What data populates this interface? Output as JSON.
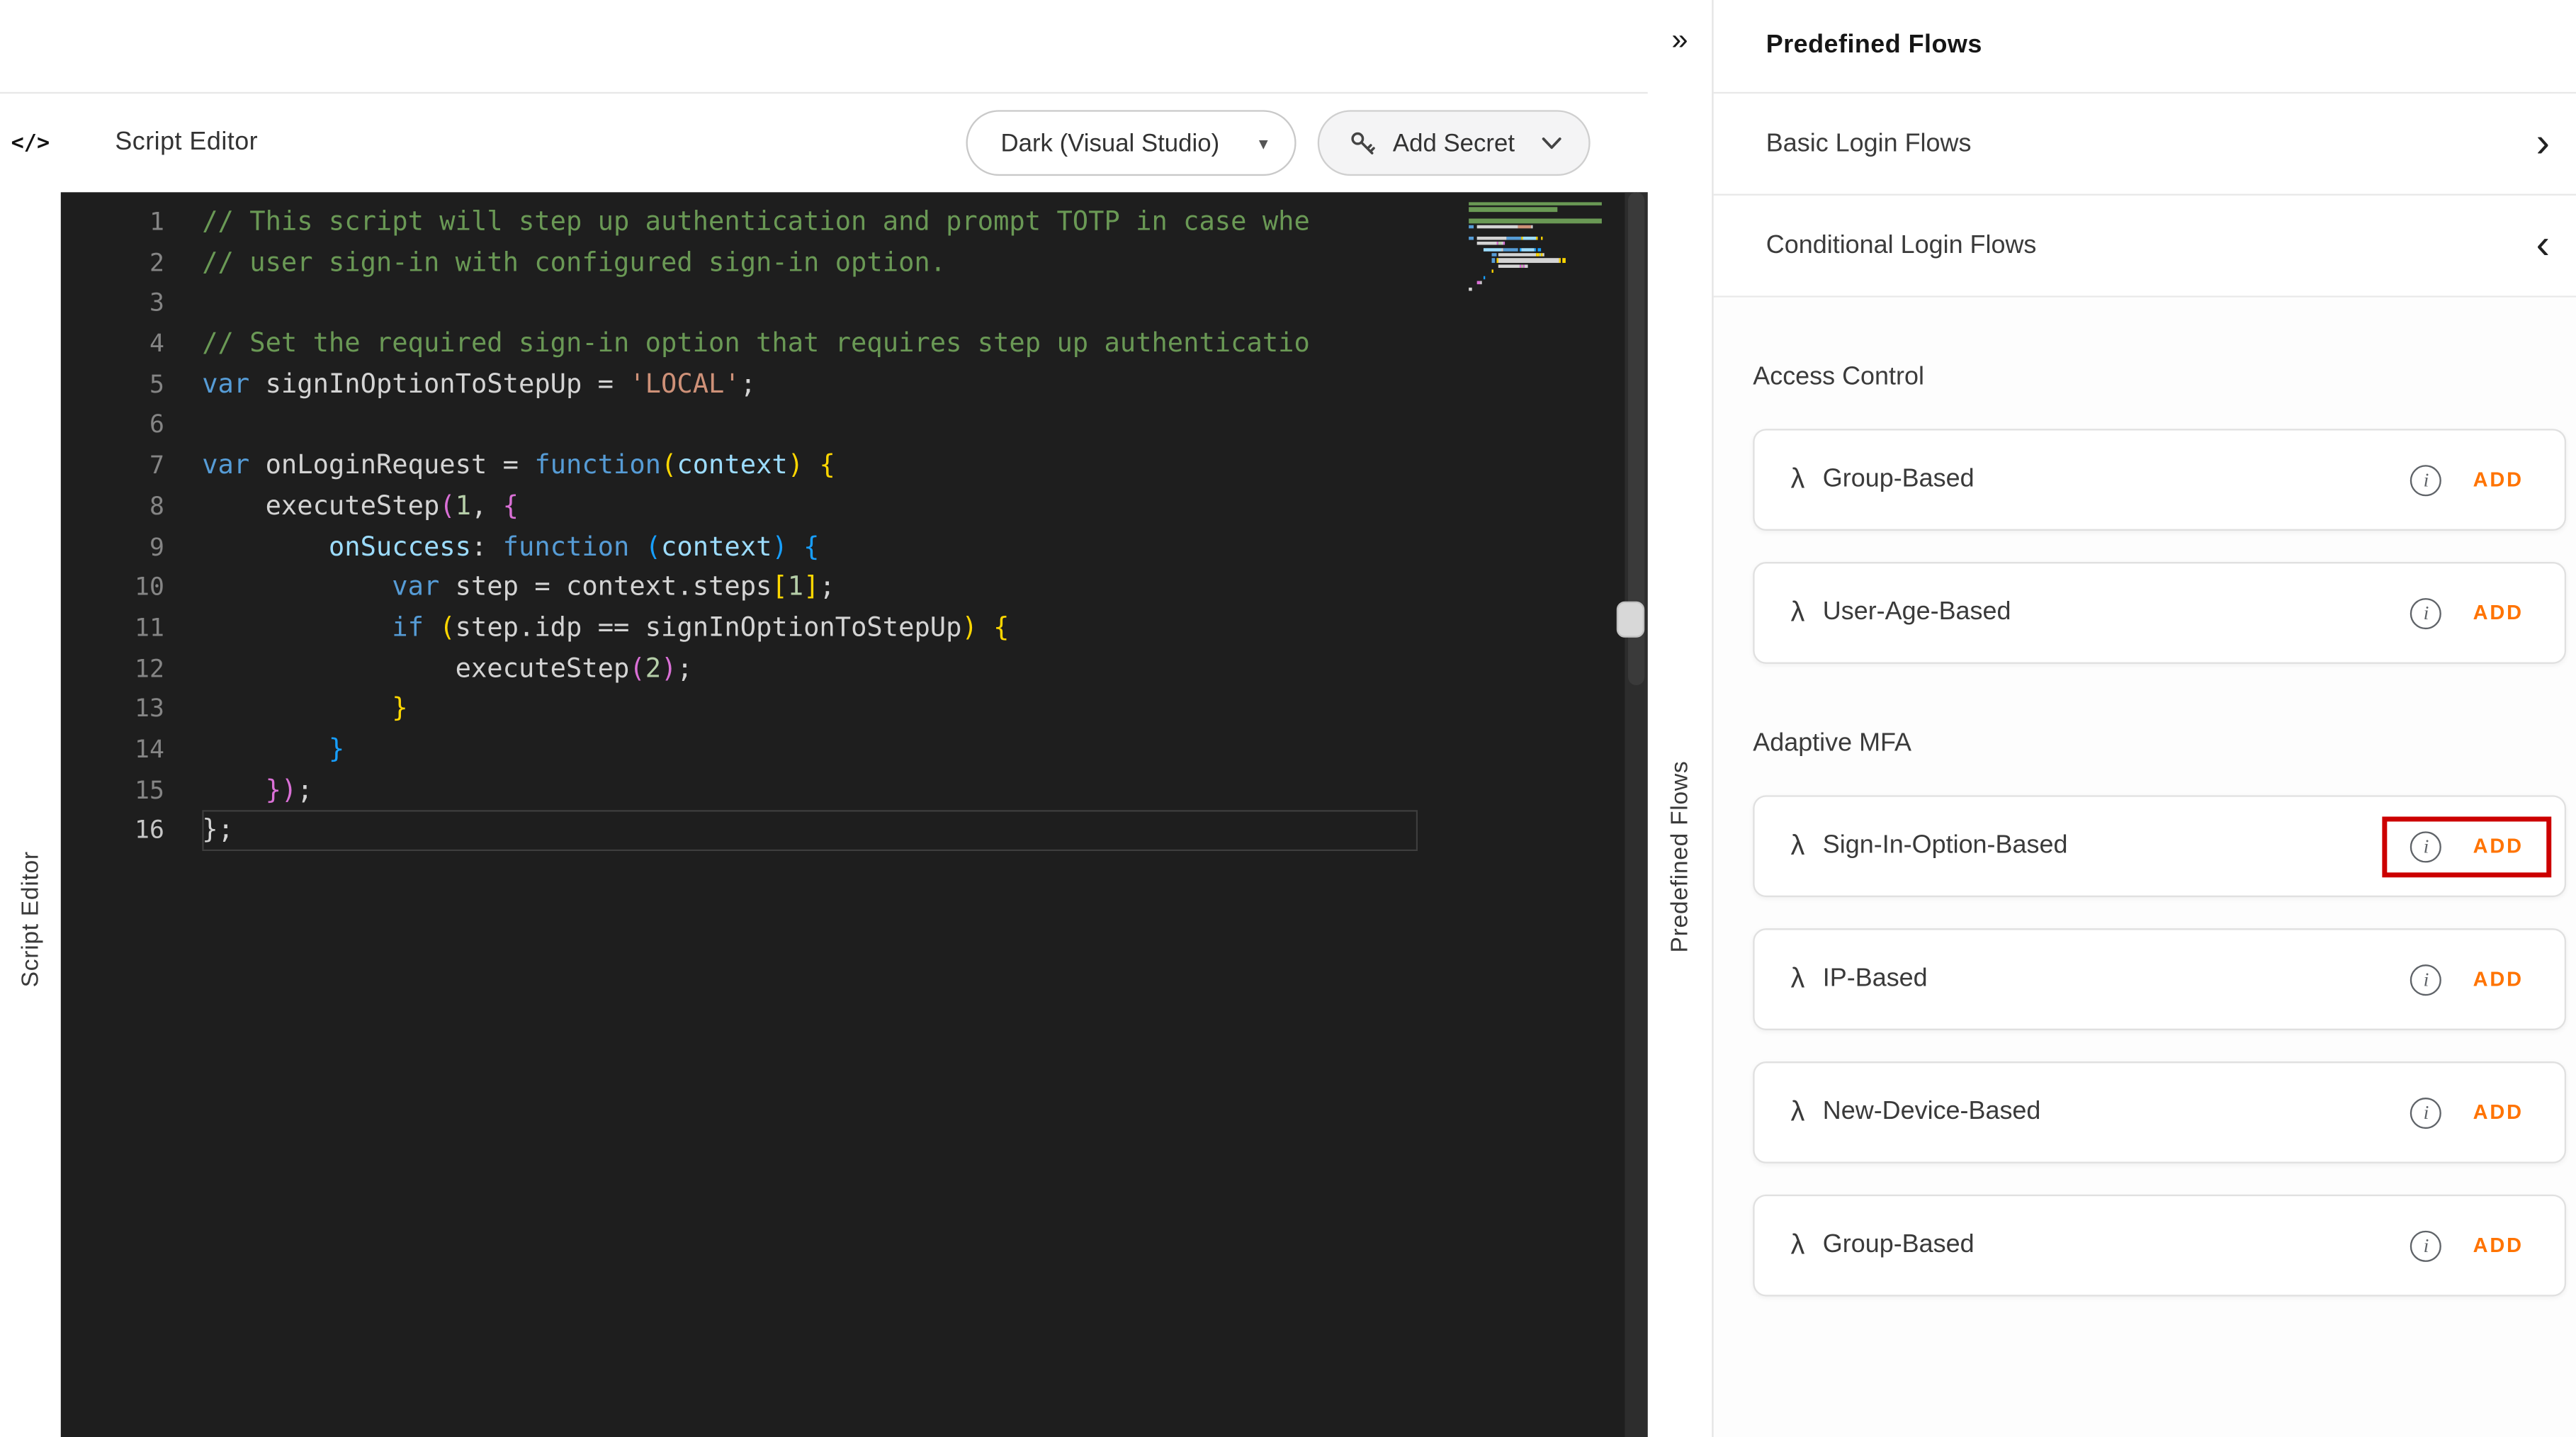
{
  "accent": {
    "orange": "#ff7300",
    "highlight_red": "#cc0000",
    "editor_bg": "#1e1e1e"
  },
  "editor_panel": {
    "code_icon": "</>",
    "title": "Script Editor",
    "vertical_label": "Script Editor",
    "theme_dropdown_value": "Dark (Visual Studio)",
    "theme_dropdown_caret": "▾",
    "add_secret_label": "Add Secret"
  },
  "editor": {
    "lines": [
      {
        "n": 1,
        "t": [
          [
            "cm",
            "// This script will step up authentication and prompt TOTP in case whe"
          ]
        ]
      },
      {
        "n": 2,
        "t": [
          [
            "cm",
            "// user sign-in with configured sign-in option."
          ]
        ]
      },
      {
        "n": 3,
        "t": []
      },
      {
        "n": 4,
        "t": [
          [
            "cm",
            "// Set the required sign-in option that requires step up authenticatio"
          ]
        ]
      },
      {
        "n": 5,
        "t": [
          [
            "kw",
            "var"
          ],
          [
            "id",
            " signInOptionToStepUp = "
          ],
          [
            "str",
            "'LOCAL'"
          ],
          [
            "id",
            ";"
          ]
        ]
      },
      {
        "n": 6,
        "t": []
      },
      {
        "n": 7,
        "t": [
          [
            "kw",
            "var"
          ],
          [
            "id",
            " onLoginRequest = "
          ],
          [
            "kw",
            "function"
          ],
          [
            "b1",
            "("
          ],
          [
            "prm",
            "context"
          ],
          [
            "b1",
            ")"
          ],
          [
            "id",
            " "
          ],
          [
            "b1",
            "{"
          ]
        ]
      },
      {
        "n": 8,
        "t": [
          [
            "id",
            "    executeStep"
          ],
          [
            "b2",
            "("
          ],
          [
            "num",
            "1"
          ],
          [
            "id",
            ", "
          ],
          [
            "b2",
            "{"
          ]
        ]
      },
      {
        "n": 9,
        "t": [
          [
            "id",
            "        "
          ],
          [
            "prop",
            "onSuccess"
          ],
          [
            "id",
            ": "
          ],
          [
            "kw",
            "function"
          ],
          [
            "id",
            " "
          ],
          [
            "b3",
            "("
          ],
          [
            "prm",
            "context"
          ],
          [
            "b3",
            ")"
          ],
          [
            "id",
            " "
          ],
          [
            "b3",
            "{"
          ]
        ]
      },
      {
        "n": 10,
        "t": [
          [
            "id",
            "            "
          ],
          [
            "kw",
            "var"
          ],
          [
            "id",
            " step = context.steps"
          ],
          [
            "b1",
            "["
          ],
          [
            "num",
            "1"
          ],
          [
            "b1",
            "]"
          ],
          [
            "id",
            ";"
          ]
        ]
      },
      {
        "n": 11,
        "t": [
          [
            "id",
            "            "
          ],
          [
            "kw",
            "if"
          ],
          [
            "id",
            " "
          ],
          [
            "b1",
            "("
          ],
          [
            "id",
            "step.idp == signInOptionToStepUp"
          ],
          [
            "b1",
            ")"
          ],
          [
            "id",
            " "
          ],
          [
            "b1",
            "{"
          ]
        ]
      },
      {
        "n": 12,
        "t": [
          [
            "id",
            "                executeStep"
          ],
          [
            "b2",
            "("
          ],
          [
            "num",
            "2"
          ],
          [
            "b2",
            ")"
          ],
          [
            "id",
            ";"
          ]
        ]
      },
      {
        "n": 13,
        "t": [
          [
            "b1",
            "            }"
          ]
        ]
      },
      {
        "n": 14,
        "t": [
          [
            "b3",
            "        }"
          ]
        ]
      },
      {
        "n": 15,
        "t": [
          [
            "id",
            "    "
          ],
          [
            "b2",
            "})"
          ],
          [
            "id",
            ";"
          ]
        ]
      },
      {
        "n": 16,
        "t": [
          [
            "id",
            "};"
          ]
        ],
        "active": true
      }
    ]
  },
  "right_panel": {
    "collapse_icon": "»",
    "title": "Predefined Flows",
    "vertical_label": "Predefined Flows",
    "accordions": [
      {
        "label": "Basic Login Flows",
        "chevron": "›",
        "state": "collapsed"
      },
      {
        "label": "Conditional Login Flows",
        "chevron": "‹",
        "state": "expanded"
      }
    ],
    "sections": [
      {
        "title": "Access Control",
        "flows": [
          {
            "name": "Group-Based"
          },
          {
            "name": "User-Age-Based"
          }
        ]
      },
      {
        "title": "Adaptive MFA",
        "flows": [
          {
            "name": "Sign-In-Option-Based",
            "highlighted": true
          },
          {
            "name": "IP-Based"
          },
          {
            "name": "New-Device-Based"
          },
          {
            "name": "Group-Based"
          }
        ]
      }
    ],
    "lambda_icon": "λ",
    "info_icon": "i",
    "add_label": "ADD"
  }
}
